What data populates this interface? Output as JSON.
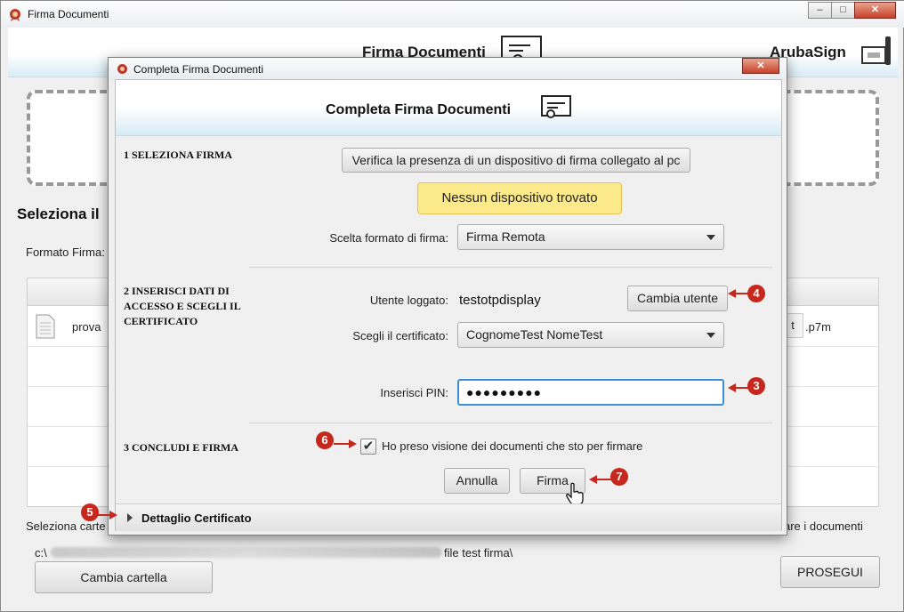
{
  "window": {
    "title": "Firma Documenti",
    "header_title": "Firma Documenti",
    "brand": "ArubaSign",
    "minimize": "–",
    "maximize": "□",
    "close": "✕"
  },
  "background": {
    "section_title": "Seleziona il",
    "format_label": "Formato Firma:",
    "file_name": "prova",
    "file_ext": ".p7m",
    "file_ext_prefix": "t",
    "folder_hint_left": "Seleziona carte",
    "folder_hint_right": "are i documenti",
    "folder_path": "c:\\",
    "folder_path_end": "file test firma\\",
    "change_folder_button": "Cambia cartella",
    "next_button": "PROSEGUI"
  },
  "dialog": {
    "title": "Completa Firma Documenti",
    "header_title": "Completa Firma Documenti",
    "close": "✕",
    "section1": {
      "label": "1 SELEZIONA FIRMA",
      "check_device_button": "Verifica la presenza di un dispositivo di firma collegato al pc",
      "status_message": "Nessun dispositivo trovato",
      "format_label": "Scelta formato di firma:",
      "format_value": "Firma Remota"
    },
    "section2": {
      "label_line1": "2 INSERISCI DATI DI",
      "label_line2": "ACCESSO E SCEGLI IL",
      "label_line3": "CERTIFICATO",
      "user_label": "Utente loggato:",
      "user_value": "testotpdisplay",
      "change_user_button": "Cambia utente",
      "cert_label": "Scegli il certificato:",
      "cert_value": "CognomeTest NomeTest",
      "pin_label": "Inserisci PIN:",
      "pin_value": "●●●●●●●●●"
    },
    "section3": {
      "label": "3 CONCLUDI E FIRMA",
      "confirm_checkbox_label": "Ho preso visione dei documenti che sto per firmare",
      "confirm_checked": true,
      "cancel_button": "Annulla",
      "sign_button": "Firma"
    },
    "details_toggle": "Dettaglio Certificato"
  },
  "annotations": {
    "marker_3": "3",
    "marker_4": "4",
    "marker_5": "5",
    "marker_6": "6",
    "marker_7": "7"
  },
  "colors": {
    "status_bg": "#fbe98a",
    "status_border": "#e0c25a",
    "marker": "#c7281e",
    "pin_border": "#3c8fd6",
    "header_gradient_end": "#d6ebf6"
  },
  "icons": {
    "app_icon": "aruba-seal-icon",
    "certificate_icon": "certificate-icon",
    "smartcard_reader_icon": "smartcard-reader-icon",
    "file_icon": "document-icon",
    "hand_cursor": "hand-cursor-icon",
    "checkmark": "✔"
  }
}
